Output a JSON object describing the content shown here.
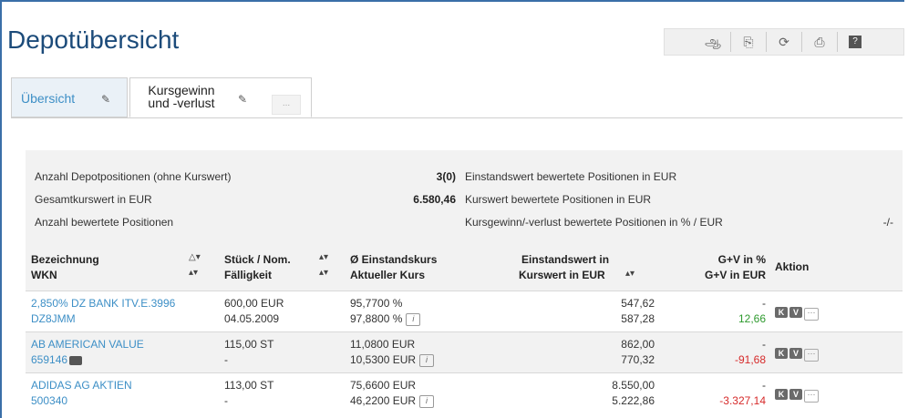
{
  "title": "Depotübersicht",
  "toolbar": {
    "icons": [
      "eye-search-icon",
      "export-icon",
      "refresh-icon",
      "print-icon",
      "help-icon"
    ],
    "glyphs": [
      "ஆ",
      "⎘",
      "⟳",
      "⎙",
      "?"
    ]
  },
  "tabs": {
    "overview": "Übersicht",
    "gain_loss": "Kursgewinn und -verlust",
    "more": "..."
  },
  "summary": {
    "count_label": "Anzahl Depotpositionen (ohne Kurswert)",
    "count_value": "3(0)",
    "total_label": "Gesamtkurswert in EUR",
    "total_value": "6.580,46",
    "rated_label": "Anzahl bewertete Positionen",
    "cost_label": "Einstandswert bewertete Positionen in EUR",
    "market_label": "Kurswert bewertete Positionen in EUR",
    "gv_label": "Kursgewinn/-verlust bewertete Positionen in % / EUR",
    "gv_value": "-/-"
  },
  "table": {
    "h_name": "Bezeichnung",
    "h_wkn": "WKN",
    "h_qty": "Stück / Nom.",
    "h_due": "Fälligkeit",
    "h_avg": "Ø Einstandskurs",
    "h_cur": "Aktueller Kurs",
    "h_cost": "Einstandswert in",
    "h_value": "Kurswert in EUR",
    "h_gvp": "G+V in %",
    "h_gve": "G+V in EUR",
    "h_action": "Aktion",
    "rows": [
      {
        "name": "2,850% DZ BANK ITV.E.3996",
        "wkn": "DZ8JMM",
        "qty": "600,00 EUR",
        "due": "04.05.2009",
        "avg": "95,7700 %",
        "cur": "97,8800 %",
        "cost": "547,62",
        "value": "587,28",
        "gvp": "-",
        "gve": "12,66"
      },
      {
        "name": "AB AMERICAN VALUE",
        "wkn": "659146",
        "qty": "115,00 ST",
        "due": "-",
        "avg": "11,0800 EUR",
        "cur": "10,5300 EUR",
        "cost": "862,00",
        "value": "770,32",
        "gvp": "-",
        "gve": "-91,68"
      },
      {
        "name": "ADIDAS AG AKTIEN",
        "wkn": "500340",
        "qty": "113,00 ST",
        "due": "-",
        "avg": "75,6600 EUR",
        "cur": "46,2200 EUR",
        "cost": "8.550,00",
        "value": "5.222,86",
        "gvp": "-",
        "gve": "-3.327,14"
      }
    ],
    "info_glyph": "i",
    "badge_k": "K",
    "badge_v": "V",
    "dots": "···"
  }
}
